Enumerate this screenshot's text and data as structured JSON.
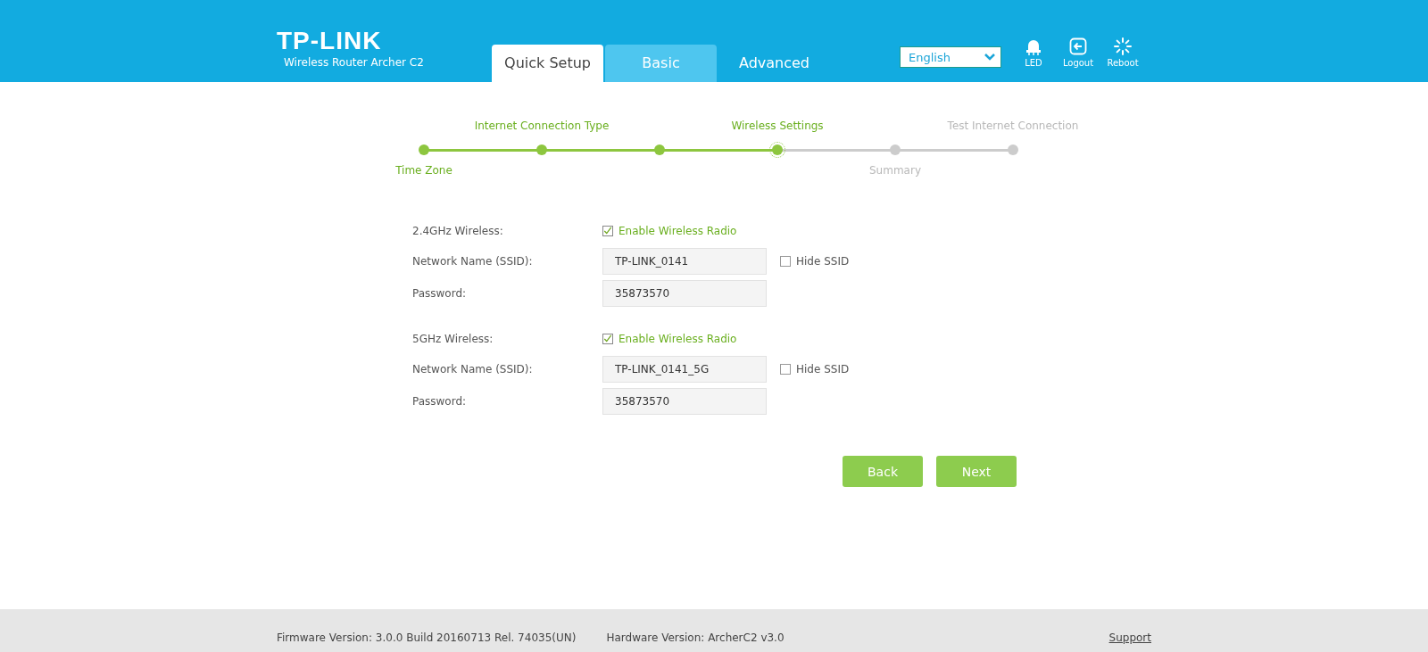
{
  "header": {
    "logo": "TP-LINK",
    "model": "Wireless Router Archer C2",
    "tabs": [
      {
        "label": "Quick Setup",
        "selected": true
      },
      {
        "label": "Basic",
        "selected": false
      },
      {
        "label": "Advanced",
        "selected": false
      }
    ],
    "language": {
      "value": "English"
    },
    "tools": [
      {
        "kind": "led",
        "label": "LED"
      },
      {
        "kind": "logout",
        "label": "Logout"
      },
      {
        "kind": "reboot",
        "label": "Reboot"
      }
    ]
  },
  "steps": [
    {
      "label": "Time Zone",
      "done": true,
      "current": false
    },
    {
      "label": "Internet Connection Type",
      "done": true,
      "current": false
    },
    {
      "done": true,
      "current": false
    },
    {
      "label": "Wireless Settings",
      "done": false,
      "current": true
    },
    {
      "label": "Summary",
      "done": false,
      "current": false
    },
    {
      "label": "Test Internet Connection",
      "done": false,
      "current": false
    }
  ],
  "bands": [
    {
      "label": "2.4GHz Wireless:",
      "radio_label": "Enable Wireless Radio",
      "radio_checked": true,
      "ssid_label": "Network Name (SSID):",
      "ssid": "TP-LINK_0141",
      "hide_label": "Hide SSID",
      "hide_checked": false,
      "password_label": "Password:",
      "password": "35873570"
    },
    {
      "label": "5GHz Wireless:",
      "radio_label": "Enable Wireless Radio",
      "radio_checked": true,
      "ssid_label": "Network Name (SSID):",
      "ssid": "TP-LINK_0141_5G",
      "hide_label": "Hide SSID",
      "hide_checked": false,
      "password_label": "Password:",
      "password": "35873570"
    }
  ],
  "buttons": [
    "Back",
    "Next"
  ],
  "footer": {
    "firmware": "Firmware Version: 3.0.0 Build 20160713 Rel. 74035(UN)",
    "hardware": "Hardware Version: ArcherC2 v3.0",
    "support": "Support"
  }
}
